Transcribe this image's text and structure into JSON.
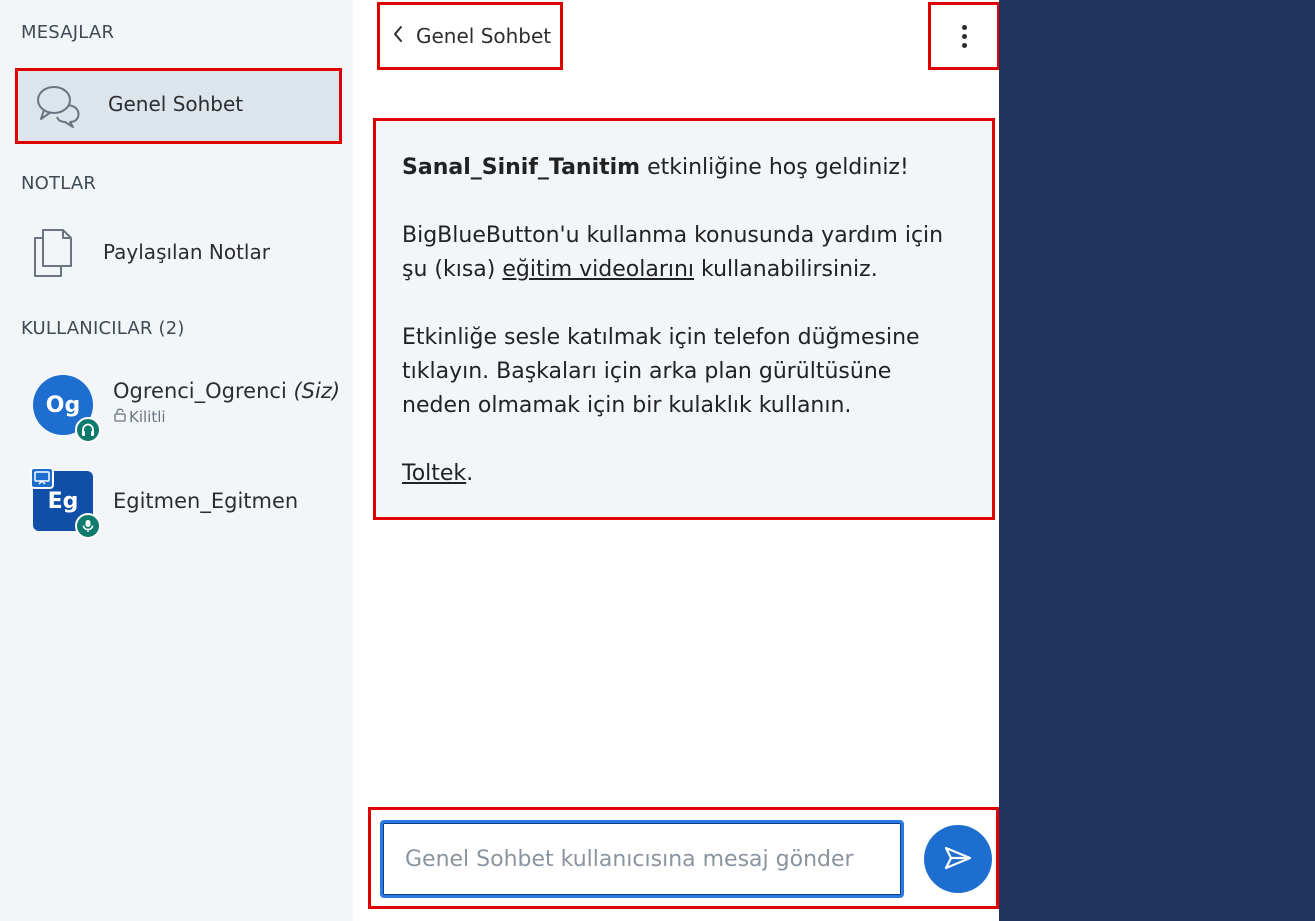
{
  "sidebar": {
    "messages_title": "MESAJLAR",
    "chat_item_label": "Genel Sohbet",
    "notes_title": "NOTLAR",
    "notes_item_label": "Paylaşılan Notlar",
    "users_title": "KULLANICILAR (2)",
    "users": [
      {
        "initials": "Og",
        "name": "Ogrenci_Ogrenci",
        "suffix": "(Siz)",
        "sub": "Kilitli",
        "avatar_shape": "round",
        "status_icon": "headset-icon"
      },
      {
        "initials": "Eg",
        "name": "Egitmen_Egitmen",
        "suffix": "",
        "sub": "",
        "avatar_shape": "square",
        "status_icon": "microphone-icon",
        "presenter_icon": "presenter-icon"
      }
    ]
  },
  "chat": {
    "header_title": "Genel Sohbet",
    "welcome": {
      "title_bold": "Sanal_Sinif_Tanitim",
      "title_rest": " etkinliğine hoş geldiniz!",
      "p2_before": "BigBlueButton'u kullanma konusunda yardım için şu (kısa) ",
      "p2_link": "eğitim videolarını",
      "p2_after": " kullanabilirsiniz.",
      "p3": "Etkinliğe sesle katılmak için telefon düğmesine tıklayın. Başkaları için arka plan gürültüsüne neden olmamak için bir kulaklık kullanın.",
      "p4_link": "Toltek",
      "p4_after": "."
    },
    "input_placeholder": "Genel Sohbet kullanıcısına mesaj gönder",
    "input_value": ""
  },
  "colors": {
    "sidebar_bg": "#f3f6f9",
    "accent_blue": "#1d6ecf",
    "highlight_red": "#e00000",
    "dark_panel": "#1f3560",
    "status_green": "#0f7b6c"
  }
}
